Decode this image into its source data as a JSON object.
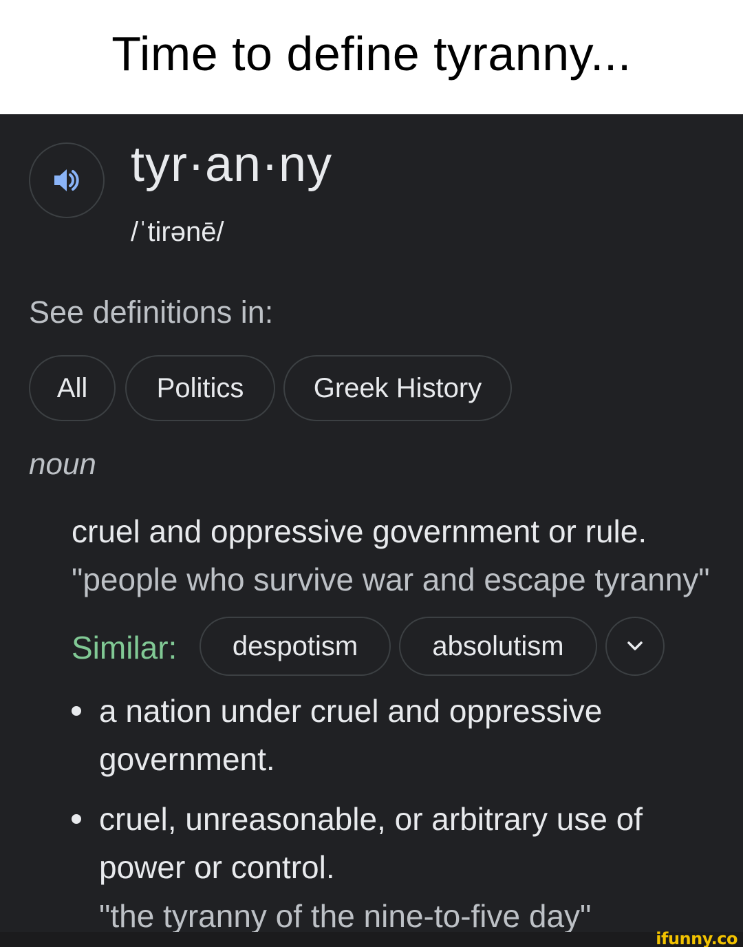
{
  "caption": {
    "text": "Time to define tyranny..."
  },
  "entry": {
    "word": "tyr·an·ny",
    "phonetic": "/ˈtirənē/",
    "speaker_icon": "speaker-icon"
  },
  "see_definitions": {
    "label": "See definitions in:",
    "chips": [
      "All",
      "Politics",
      "Greek History"
    ]
  },
  "part_of_speech": "noun",
  "definitions": [
    {
      "text": "cruel and oppressive government or rule.",
      "example": "\"people who survive war and escape tyranny\"",
      "similar": {
        "label": "Similar:",
        "words": [
          "despotism",
          "absolutism"
        ],
        "expand_icon": "chevron-down-icon"
      }
    }
  ],
  "sub_definitions": [
    {
      "text": "a nation under cruel and oppressive government."
    },
    {
      "text": "cruel, unreasonable, or arbitrary use of power or control.",
      "example": "\"the tyranny of the nine-to-five day\""
    }
  ],
  "watermark": "ifunny.co",
  "colors": {
    "panel_bg": "#202124",
    "text_primary": "#e8eaed",
    "text_secondary": "#bdc1c6",
    "similar_green": "#81c995",
    "speaker_blue": "#8ab4f8",
    "chip_border": "#3c4043",
    "watermark_yellow": "#f2c200"
  }
}
